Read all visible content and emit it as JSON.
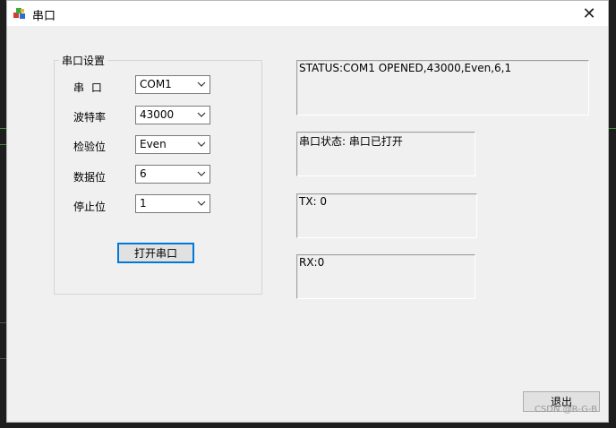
{
  "window": {
    "title": "串口",
    "close_glyph": "✕"
  },
  "settings": {
    "group_title": "串口设置",
    "fields": [
      {
        "label": "串  口",
        "value": "COM1"
      },
      {
        "label": "波特率",
        "value": "43000"
      },
      {
        "label": "检验位",
        "value": "Even"
      },
      {
        "label": "数据位",
        "value": "6"
      },
      {
        "label": "停止位",
        "value": "1"
      }
    ],
    "open_button_label": "打开串口"
  },
  "status": {
    "status_line": "STATUS:COM1 OPENED,43000,Even,6,1",
    "port_state": "串口状态: 串口已打开",
    "tx": "TX:  0",
    "rx": "RX:0"
  },
  "exit_button_label": "退出",
  "watermark": "CSDN @R-G-B",
  "icons": {
    "app": "app-colored-blocks-icon",
    "dropdown": "chevron-down-icon",
    "close": "close-icon"
  },
  "colors": {
    "focus_border": "#0078d7",
    "window_bg": "#f0f0f0",
    "titlebar_bg": "#ffffff"
  }
}
